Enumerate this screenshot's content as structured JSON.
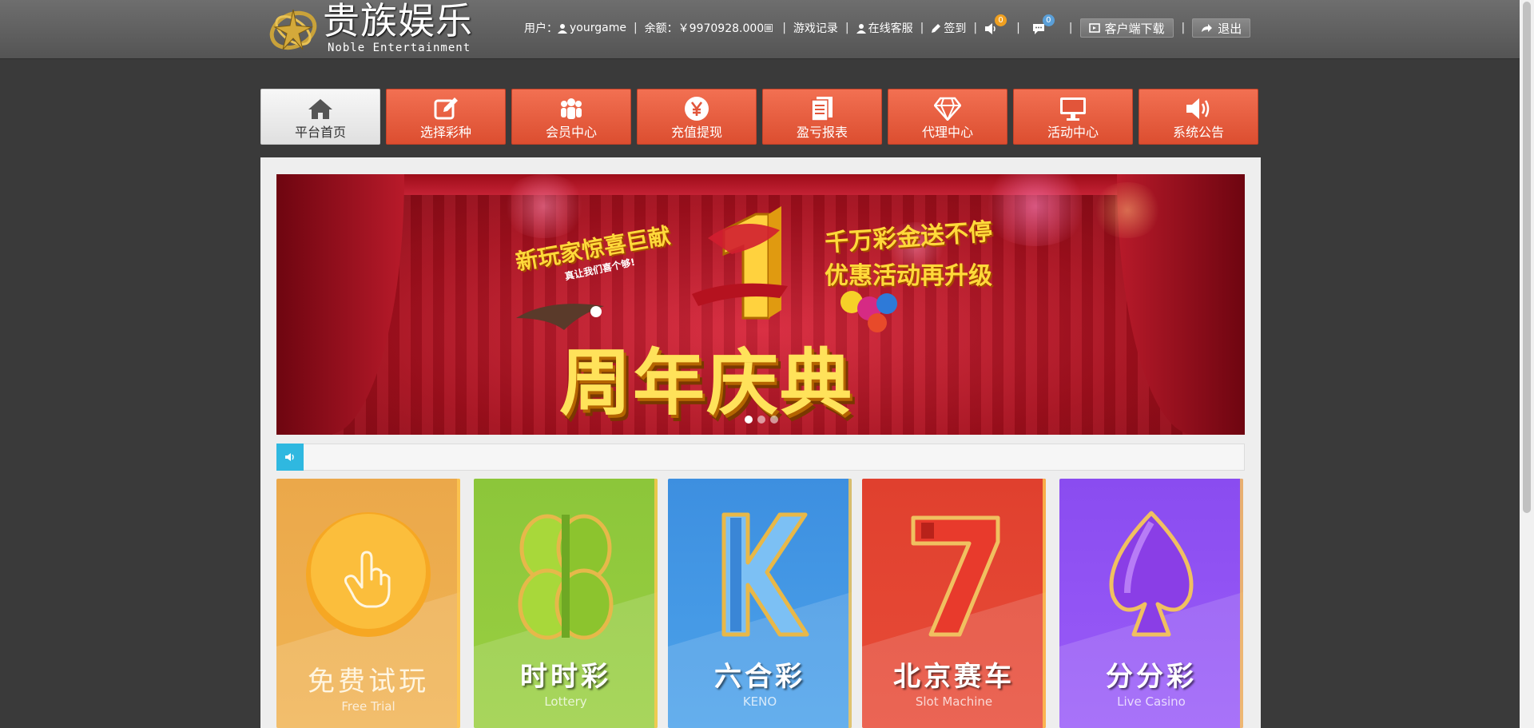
{
  "header": {
    "logo_cn": "贵族娱乐",
    "logo_en": "Noble Entertainment",
    "user_label": "用户：",
    "username": "yourgame",
    "balance_label": "余额：",
    "balance_value": "￥9970928.000",
    "game_records": "游戏记录",
    "online_service": "在线客服",
    "sign_in": "签到",
    "notice_count": "0",
    "message_count": "0",
    "client_download": "客户端下载",
    "logout": "退出",
    "separator": "|"
  },
  "nav": [
    {
      "label": "平台首页",
      "icon": "home-icon",
      "active": true
    },
    {
      "label": "选择彩种",
      "icon": "edit-icon"
    },
    {
      "label": "会员中心",
      "icon": "users-icon"
    },
    {
      "label": "充值提现",
      "icon": "yen-icon"
    },
    {
      "label": "盈亏报表",
      "icon": "report-icon"
    },
    {
      "label": "代理中心",
      "icon": "diamond-icon"
    },
    {
      "label": "活动中心",
      "icon": "monitor-icon"
    },
    {
      "label": "系统公告",
      "icon": "speaker-icon"
    }
  ],
  "banner": {
    "left_text": "新玩家惊喜巨献",
    "small_text": "真让我们喜个够!",
    "right_line1": "千万彩金送不停",
    "right_line2": "优惠活动再升级",
    "main_text": "周年庆典",
    "slides": 3,
    "active_slide": 1
  },
  "cards": [
    {
      "title": "免费试玩",
      "subtitle": "Free Trial",
      "color": "#f0ac4e"
    },
    {
      "title": "时时彩",
      "subtitle": "Lottery",
      "color": "#92c83e"
    },
    {
      "title": "六合彩",
      "subtitle": "KENO",
      "color": "#4598e6"
    },
    {
      "title": "北京赛车",
      "subtitle": "Slot Machine",
      "color": "#e44632"
    },
    {
      "title": "分分彩",
      "subtitle": "Live Casino",
      "color": "#9254f4"
    }
  ],
  "colors": {
    "nav_red": "#e85c3e",
    "notice_blue": "#2fb8e0",
    "header_grey": "#606060",
    "page_bg": "#3a3a3a"
  }
}
